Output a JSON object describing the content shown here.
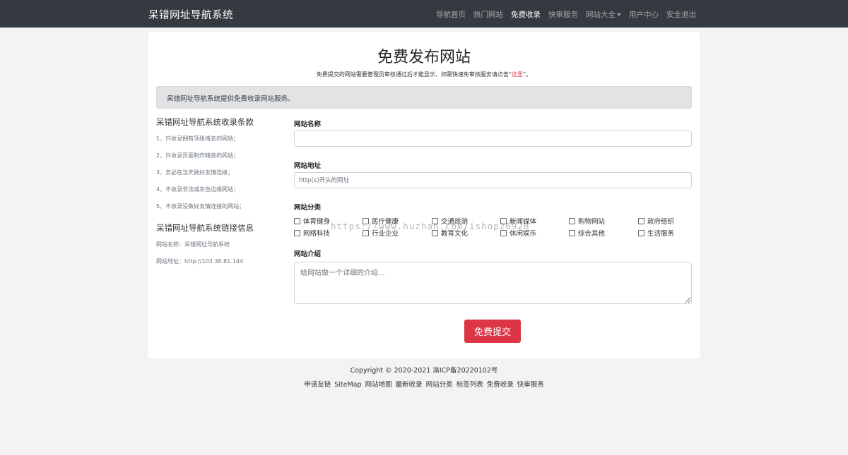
{
  "navbar": {
    "brand": "呆错网址导航系统",
    "items": [
      {
        "label": "导航首页"
      },
      {
        "label": "热门网站"
      },
      {
        "label": "免费收录"
      },
      {
        "label": "快审服务"
      },
      {
        "label": "网站大全"
      },
      {
        "label": "用户中心"
      },
      {
        "label": "安全退出"
      }
    ]
  },
  "header": {
    "title": "免费发布网站",
    "subtitle_prefix": "免费提交的网站需要管理员审核通过后才能显示、如需快速免审核服务请点击“",
    "subtitle_link": "这里",
    "subtitle_suffix": "”。"
  },
  "alert": "呆错网址导航系统提供免费收录网站服务。",
  "sidebar": {
    "rules_title": "呆错网址导航系统收录条款",
    "rules": [
      "1、只收录拥有顶级域名的网站；",
      "2、只收录页面制作精良的网站；",
      "3、务必在当天做好友情连接；",
      "4、不收录非法或灰色边缘网站；",
      "5、不收录没做好友情连接的网站；"
    ],
    "link_title": "呆错网址导航系统链接信息",
    "link_name": "网站名称：呆错网址导航系统",
    "link_url": "网站地址：http://103.38.81.144"
  },
  "form": {
    "name_label": "网站名称",
    "name_value": "",
    "url_label": "网站地址",
    "url_placeholder": "http(s)开头的网址",
    "category_label": "网站分类",
    "categories": [
      "体育健身",
      "医疗健康",
      "交通旅游",
      "新闻媒体",
      "购物网站",
      "政府组织",
      "网络科技",
      "行业企业",
      "教育文化",
      "休闲娱乐",
      "综合其他",
      "生活服务"
    ],
    "intro_label": "网站介绍",
    "intro_placeholder": "给网站做一个详细的介绍...",
    "submit_label": "免费提交"
  },
  "watermark": "https://www.huzhan.com/ishop20928",
  "footer": {
    "copyright": "Copyright © 2020-2021 渝ICP备20220102号",
    "links": [
      "申请友链",
      "SiteMap",
      "网站地图",
      "最新收录",
      "网站分类",
      "标签列表",
      "免费收录",
      "快审服务"
    ]
  }
}
